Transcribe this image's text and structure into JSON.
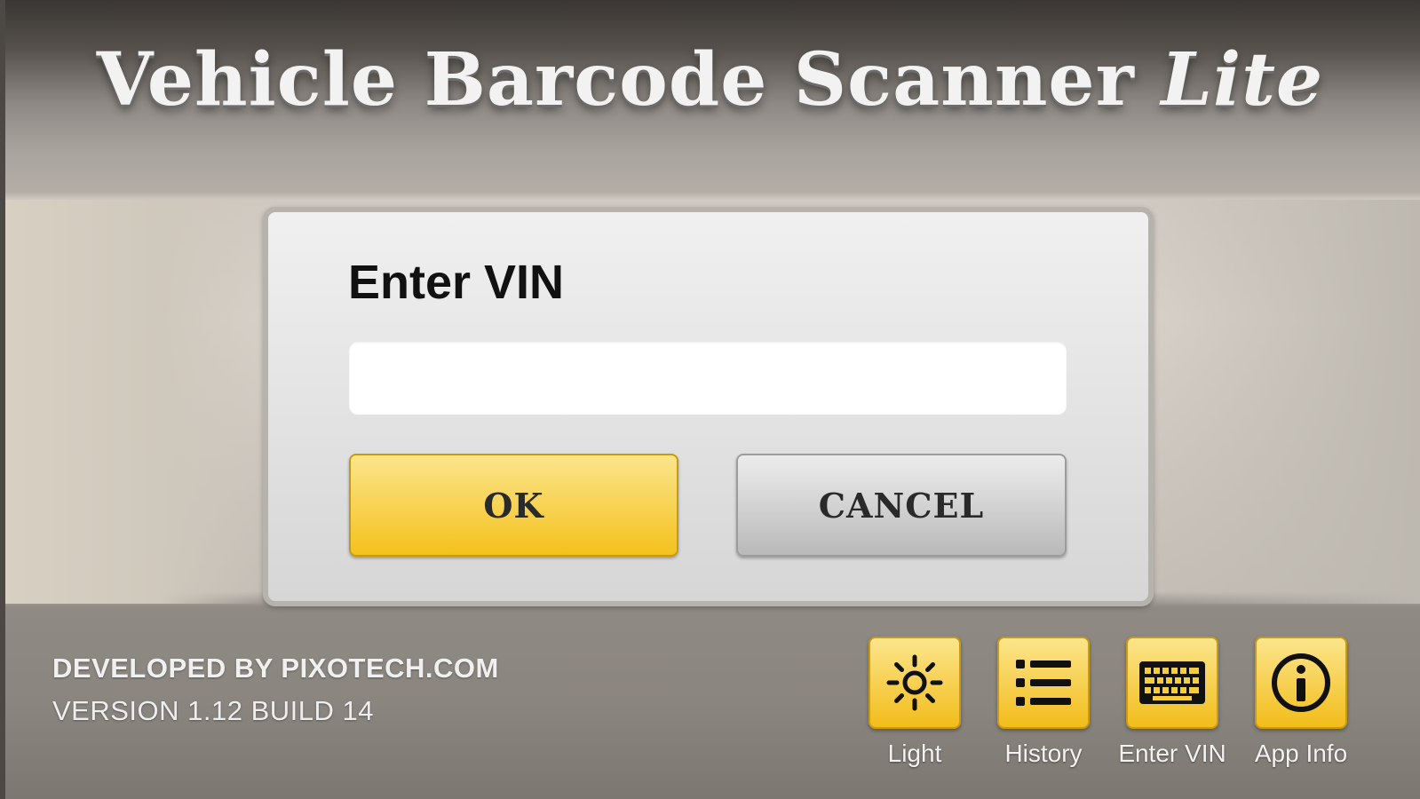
{
  "app": {
    "title_main": "Vehicle Barcode Scanner",
    "title_suffix": "Lite"
  },
  "dialog": {
    "title": "Enter VIN",
    "input_value": "",
    "ok_label": "OK",
    "cancel_label": "CANCEL"
  },
  "footer": {
    "developer": "DEVELOPED BY PIXOTECH.COM",
    "version": "VERSION 1.12 BUILD 14"
  },
  "toolbar": [
    {
      "label": "Light",
      "icon": "sun-icon"
    },
    {
      "label": "History",
      "icon": "list-icon"
    },
    {
      "label": "Enter VIN",
      "icon": "keyboard-icon"
    },
    {
      "label": "App Info",
      "icon": "info-icon"
    }
  ],
  "colors": {
    "accent_yellow": "#f8d55a",
    "dialog_bg": "#e2e2e2"
  }
}
